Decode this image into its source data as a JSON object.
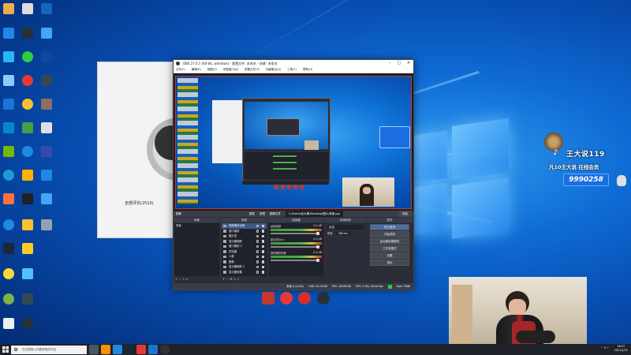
{
  "obs": {
    "title": "OBS 27.0.1 (64-bit, windows) - 配置文件: 未命名 - 场景: 未命名",
    "menu": [
      "文件(F)",
      "编辑(E)",
      "视图(V)",
      "停靠窗口(D)",
      "配置文件(P)",
      "场景集合(S)",
      "工具(T)",
      "帮助(H)"
    ],
    "status_bar": {
      "left": "图像",
      "props_label": "属性",
      "filters_label": "滤镜",
      "image_file_label": "图像文件",
      "image_file_value": "C:/Users/北大毒/Desktop/图片/背景.jpg",
      "browse_label": "浏览"
    },
    "docks": {
      "scenes": {
        "title": "场景",
        "items": [
          "场景"
        ]
      },
      "sources": {
        "title": "来源",
        "items": [
          "视频捕获设备",
          "窗口捕获",
          "图片层",
          "显示器捕获",
          "窗口捕获 2",
          "浏览器",
          "人数",
          "图像",
          "显示器捕获 2",
          "显示器采集",
          "图像"
        ]
      },
      "mixer": {
        "title": "混音器",
        "channels": [
          {
            "name": "桌面音频",
            "level": "0.0 dB"
          },
          {
            "name": "麦克风/Aux",
            "level": "0.0 dB"
          },
          {
            "name": "视频捕获设备",
            "level": "0.0 dB"
          }
        ]
      },
      "transitions": {
        "title": "转场特效",
        "type_label": "淡出",
        "duration_label": "时长",
        "duration_value": "300 ms"
      },
      "controls": {
        "title": "控件",
        "buttons": [
          "停止推流",
          "开始录制",
          "启动虚拟摄像机",
          "工作室模式",
          "设置",
          "退出"
        ]
      }
    },
    "bottom_status": {
      "dropped": "丢帧 0 (0.0%)",
      "live": "LIVE: 01:35:00",
      "rec": "REC: 00:00:00",
      "cpu": "CPU: 3.3%, 30.00 fps",
      "bitrate": "kb/s: 3506"
    }
  },
  "overlay": {
    "streamer_name": "王大说119",
    "subtitle": "凡10王大说 在线会员",
    "number": "9990258"
  },
  "taskbar": {
    "search_placeholder": "在这里输入你要搜索的内容",
    "clock_time": "16:27",
    "clock_date": "2021/1/21"
  },
  "background_window": {
    "heading": "全部评论(2510)"
  },
  "desktop_icons": [
    {
      "name": "icon-1",
      "color": "#e8b04a"
    },
    {
      "name": "icon-2",
      "color": "#1e88e5"
    },
    {
      "name": "icon-3",
      "color": "#e53935"
    },
    {
      "name": "icon-4",
      "color": "#43a047"
    },
    {
      "name": "icon-5",
      "color": "#0b4aa8"
    }
  ]
}
